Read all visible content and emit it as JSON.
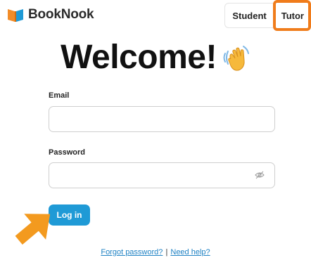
{
  "header": {
    "brand": "BookNook",
    "logo_icon": "book-icon",
    "roles": {
      "student_label": "Student",
      "tutor_label": "Tutor",
      "highlighted": "Tutor",
      "highlight_color": "#f07c1b"
    }
  },
  "main": {
    "title": "Welcome!",
    "title_icon": "waving-hand-icon"
  },
  "form": {
    "email": {
      "label": "Email",
      "value": "",
      "placeholder": ""
    },
    "password": {
      "label": "Password",
      "value": "",
      "placeholder": "",
      "toggle_icon": "eye-slash-icon"
    },
    "submit_label": "Log in",
    "submit_color": "#1f9ad6"
  },
  "annotation": {
    "arrow_color": "#f39a1f",
    "arrow_icon": "arrow-pointing-right-icon"
  },
  "footer": {
    "forgot_password": "Forgot password?",
    "separator": "|",
    "need_help": "Need help?"
  }
}
